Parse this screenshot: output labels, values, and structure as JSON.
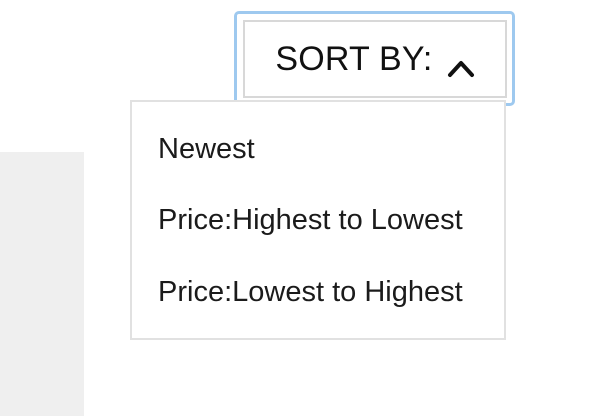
{
  "sort": {
    "label": "SORT BY:",
    "icon": "chevron-up-icon",
    "focus_color": "#9ec9ef"
  },
  "menu": {
    "items": [
      {
        "label": "Newest"
      },
      {
        "label": "Price:Highest to Lowest"
      },
      {
        "label": "Price:Lowest to Highest"
      }
    ]
  }
}
